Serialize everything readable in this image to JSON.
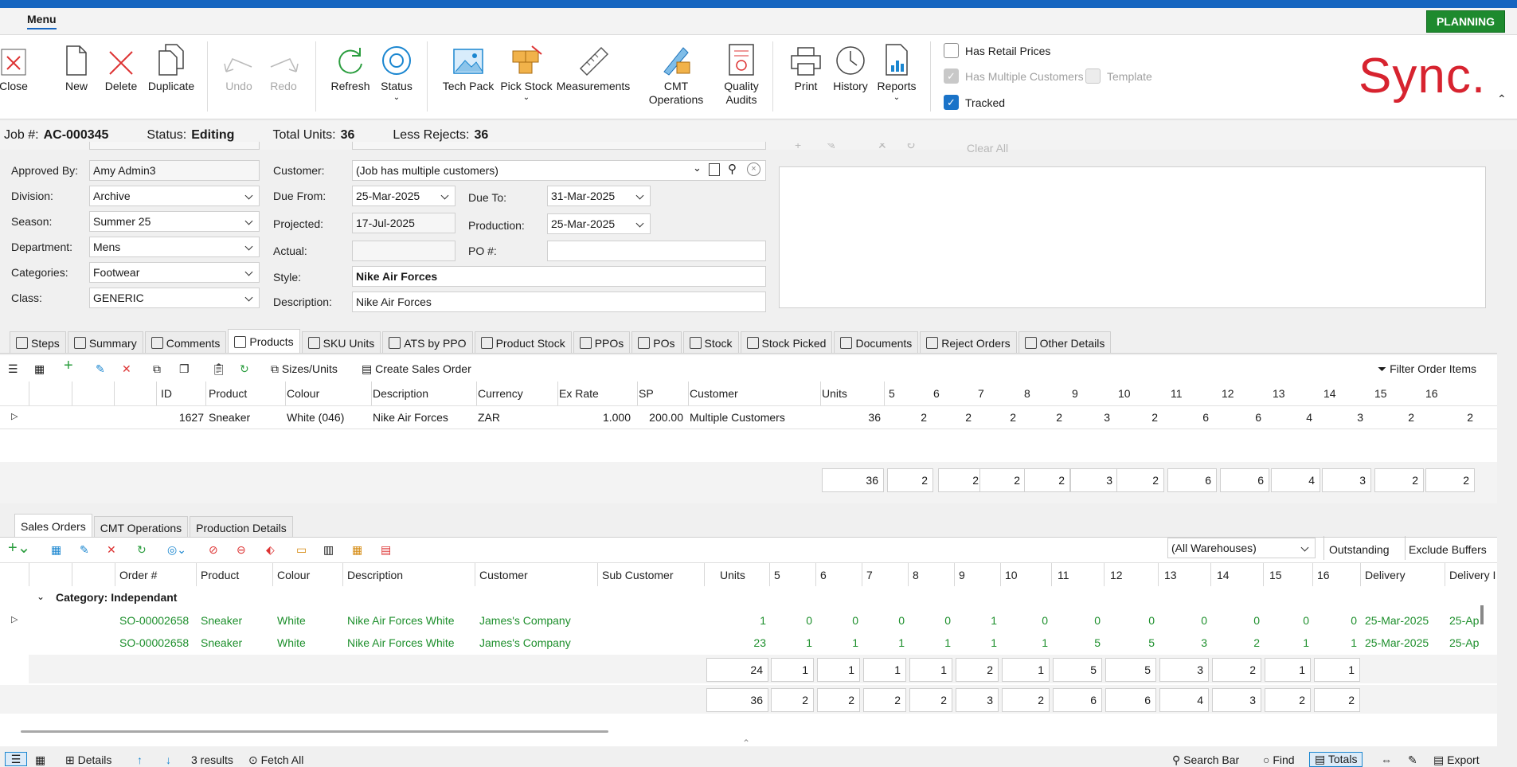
{
  "menu": {
    "tab": "Menu",
    "planning": "PLANNING"
  },
  "ribbon": {
    "close": "Close",
    "new": "New",
    "delete": "Delete",
    "duplicate": "Duplicate",
    "undo": "Undo",
    "redo": "Redo",
    "refresh": "Refresh",
    "status": "Status",
    "tech_pack": "Tech Pack",
    "pick_stock": "Pick Stock",
    "measurements": "Measurements",
    "cmt_operations": "CMT Operations",
    "quality_audits": "Quality\nAudits",
    "print": "Print",
    "history": "History",
    "reports": "Reports"
  },
  "options": {
    "has_retail_prices": "Has Retail Prices",
    "has_multiple_customers": "Has Multiple Customers",
    "template": "Template",
    "tracked": "Tracked"
  },
  "logo": "Sync.",
  "job": {
    "job_label": "Job #:",
    "job_value": "AC-000345",
    "status_label": "Status:",
    "status_value": "Editing",
    "total_label": "Total Units:",
    "total_value": "36",
    "less_label": "Less Rejects:",
    "less_value": "36"
  },
  "form": {
    "approved_by_label": "Approved By:",
    "approved_by": "Amy Admin3",
    "division_label": "Division:",
    "division": "Archive",
    "season_label": "Season:",
    "season": "Summer 25",
    "department_label": "Department:",
    "department": "Mens",
    "categories_label": "Categories:",
    "categories": "Footwear",
    "class_label": "Class:",
    "class": "GENERIC",
    "customer_label": "Customer:",
    "customer": "(Job has multiple customers)",
    "due_from_label": "Due From:",
    "due_from": "25-Mar-2025",
    "due_to_label": "Due To:",
    "due_to": "31-Mar-2025",
    "projected_label": "Projected:",
    "projected": "17-Jul-2025",
    "production_label": "Production:",
    "production": "25-Mar-2025",
    "actual_label": "Actual:",
    "actual": "",
    "po_label": "PO #:",
    "po": "",
    "style_label": "Style:",
    "style": "Nike Air Forces",
    "description_label": "Description:",
    "description": "Nike Air Forces",
    "clear_all": "Clear All"
  },
  "tabs": [
    "Steps",
    "Summary",
    "Comments",
    "Products",
    "SKU Units",
    "ATS by PPO",
    "Product Stock",
    "PPOs",
    "POs",
    "Stock",
    "Stock Picked",
    "Documents",
    "Reject Orders",
    "Other Details"
  ],
  "products_toolbar": {
    "sizes_units": "Sizes/Units",
    "create_sales_order": "Create Sales Order",
    "filter_order_items": "Filter Order Items"
  },
  "products_grid": {
    "headers": [
      "ID",
      "Product",
      "Colour",
      "Description",
      "Currency",
      "Ex Rate",
      "SP",
      "Customer",
      "Units",
      "5",
      "6",
      "7",
      "8",
      "9",
      "10",
      "11",
      "12",
      "13",
      "14",
      "15",
      "16"
    ],
    "row": [
      "1627",
      "Sneaker",
      "White (046)",
      "Nike Air Forces",
      "ZAR",
      "1.000",
      "200.00",
      "Multiple Customers",
      "36",
      "2",
      "2",
      "2",
      "2",
      "3",
      "2",
      "6",
      "6",
      "4",
      "3",
      "2",
      "2"
    ],
    "totals": [
      "36",
      "2",
      "2",
      "2",
      "2",
      "3",
      "2",
      "6",
      "6",
      "4",
      "3",
      "2",
      "2"
    ]
  },
  "subtabs": [
    "Sales Orders",
    "CMT Operations",
    "Production Details"
  ],
  "sales_toolbar": {
    "warehouse": "(All Warehouses)",
    "outstanding": "Outstanding",
    "exclude_buffers": "Exclude Buffers"
  },
  "sales_grid": {
    "headers": [
      "Order #",
      "Product",
      "Colour",
      "Description",
      "Customer",
      "Sub Customer",
      "Units",
      "5",
      "6",
      "7",
      "8",
      "9",
      "10",
      "11",
      "12",
      "13",
      "14",
      "15",
      "16",
      "Delivery",
      "Delivery I"
    ],
    "group": "Category: Independant",
    "rows": [
      [
        "SO-00002658",
        "Sneaker",
        "White",
        "Nike Air Forces White",
        "James's Company",
        "",
        "1",
        "0",
        "0",
        "0",
        "0",
        "1",
        "0",
        "0",
        "0",
        "0",
        "0",
        "0",
        "0",
        "25-Mar-2025",
        "25-Ap"
      ],
      [
        "SO-00002658",
        "Sneaker",
        "White",
        "Nike Air Forces White",
        "James's Company",
        "",
        "23",
        "1",
        "1",
        "1",
        "1",
        "1",
        "1",
        "5",
        "5",
        "3",
        "2",
        "1",
        "1",
        "25-Mar-2025",
        "25-Ap"
      ]
    ],
    "totals1": [
      "24",
      "1",
      "1",
      "1",
      "1",
      "2",
      "1",
      "5",
      "5",
      "3",
      "2",
      "1",
      "1"
    ],
    "totals2": [
      "36",
      "2",
      "2",
      "2",
      "2",
      "3",
      "2",
      "6",
      "6",
      "4",
      "3",
      "2",
      "2"
    ]
  },
  "footer": {
    "details": "Details",
    "results": "3 results",
    "fetch_all": "Fetch All",
    "search_bar": "Search Bar",
    "find": "Find",
    "totals": "Totals",
    "export": "Export"
  }
}
